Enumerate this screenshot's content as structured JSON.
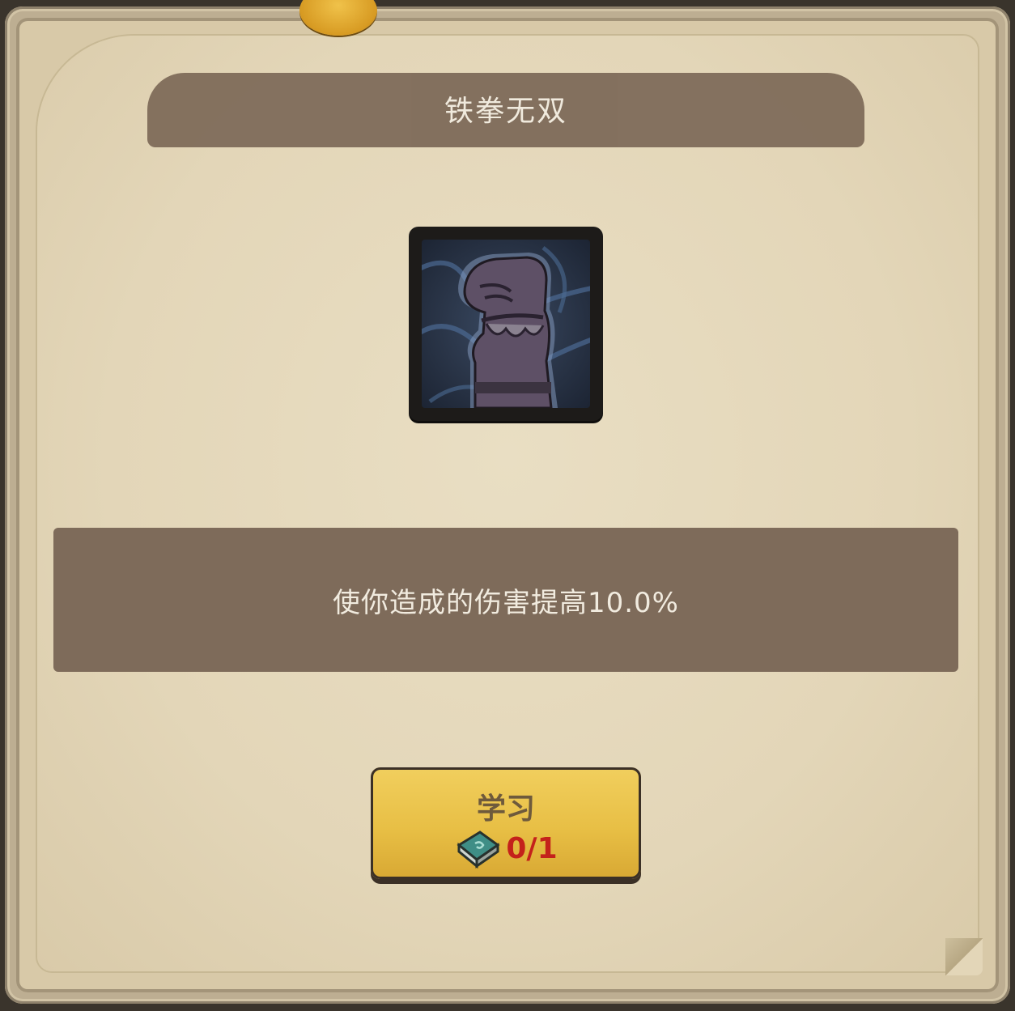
{
  "skill": {
    "title": "铁拳无双",
    "icon": "iron-fist-icon",
    "description": "使你造成的伤害提高10.0%"
  },
  "learn_button": {
    "label": "学习",
    "cost_icon": "skill-book-icon",
    "cost": "0/1"
  },
  "colors": {
    "banner": "#7e6b5a",
    "parchment": "#e3d6b8",
    "button": "#e8bf45",
    "cost_text": "#c4211b"
  }
}
